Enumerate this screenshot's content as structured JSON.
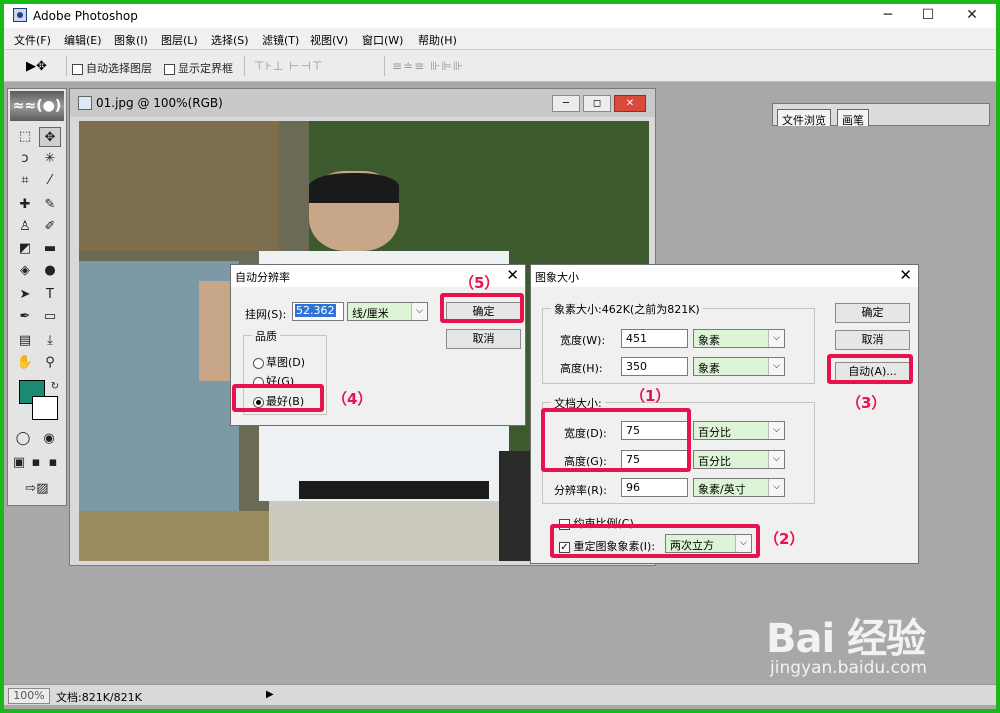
{
  "app": {
    "title": "Adobe Photoshop",
    "min": "─",
    "max": "☐",
    "close": "✕"
  },
  "menu": [
    "文件(F)",
    "编辑(E)",
    "图象(I)",
    "图层(L)",
    "选择(S)",
    "滤镜(T)",
    "视图(V)",
    "窗口(W)",
    "帮助(H)"
  ],
  "options": {
    "tool_icon": "▶✥",
    "auto_select": "自动选择图层",
    "show_bounds": "显示定界框",
    "align1": "⊤⊦⊥ ⊢⊣⊤",
    "align2": "≡≐≡ ⊪⊫⊪"
  },
  "palette_well": {
    "tabs": [
      "文件浏览",
      "画笔"
    ]
  },
  "toolbox": {
    "logo": "≈≈(●)"
  },
  "document": {
    "title": "01.jpg @ 100%(RGB)",
    "min": "─",
    "max": "◻",
    "close": "✕"
  },
  "status": {
    "zoom": "100%",
    "doc": "文档:821K/821K",
    "arrow": "▶"
  },
  "auto_res_dialog": {
    "title": "自动分辨率",
    "close": "✕",
    "screen_label": "挂网(S):",
    "screen_value": "52.362",
    "screen_unit": "线/厘米",
    "quality_label": "品质",
    "options": [
      "草图(D)",
      "好(G)",
      "最好(B)"
    ],
    "selected": "最好(B)",
    "ok": "确定",
    "cancel": "取消"
  },
  "image_size_dialog": {
    "title": "图象大小",
    "close": "✕",
    "pixel_dim_label": "象素大小:462K(之前为821K)",
    "width_label": "宽度(W):",
    "width_value": "451",
    "width_unit": "象素",
    "height_label": "高度(H):",
    "height_value": "350",
    "height_unit": "象素",
    "doc_size_label": "文档大小:",
    "doc_width_label": "宽度(D):",
    "doc_width_value": "75",
    "doc_width_unit": "百分比",
    "doc_height_label": "高度(G):",
    "doc_height_value": "75",
    "doc_height_unit": "百分比",
    "resolution_label": "分辨率(R):",
    "resolution_value": "96",
    "resolution_unit": "象素/英寸",
    "constrain_label": "约束比例(C)",
    "resample_label": "重定图象象素(I):",
    "resample_value": "两次立方",
    "ok": "确定",
    "cancel": "取消",
    "auto": "自动(A)..."
  },
  "annotations": [
    "（1）",
    "（2）",
    "（3）",
    "（4）",
    "（5）"
  ],
  "watermark": {
    "brand": "Bai 经验",
    "url": "jingyan.baidu.com"
  },
  "colors": {
    "highlight": "#e7134f",
    "foreground": "#1a8a72",
    "field_green": "#ddf5d6",
    "border": "#19b919"
  }
}
